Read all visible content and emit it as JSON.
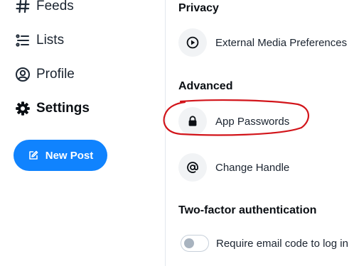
{
  "nav": {
    "items": [
      {
        "label": "Feeds",
        "icon": "hash-icon",
        "active": false
      },
      {
        "label": "Lists",
        "icon": "list-icon",
        "active": false
      },
      {
        "label": "Profile",
        "icon": "profile-icon",
        "active": false
      },
      {
        "label": "Settings",
        "icon": "gear-icon",
        "active": true
      }
    ],
    "new_post_label": "New Post"
  },
  "settings": {
    "privacy": {
      "heading": "Privacy",
      "external_media_label": "External Media Preferences"
    },
    "advanced": {
      "heading": "Advanced",
      "app_passwords_label": "App Passwords",
      "change_handle_label": "Change Handle"
    },
    "two_factor": {
      "heading": "Two-factor authentication",
      "email_code_label": "Require email code to log in",
      "email_code_enabled": false
    }
  },
  "colors": {
    "accent": "#1083fe",
    "annotation": "#d2141a"
  }
}
